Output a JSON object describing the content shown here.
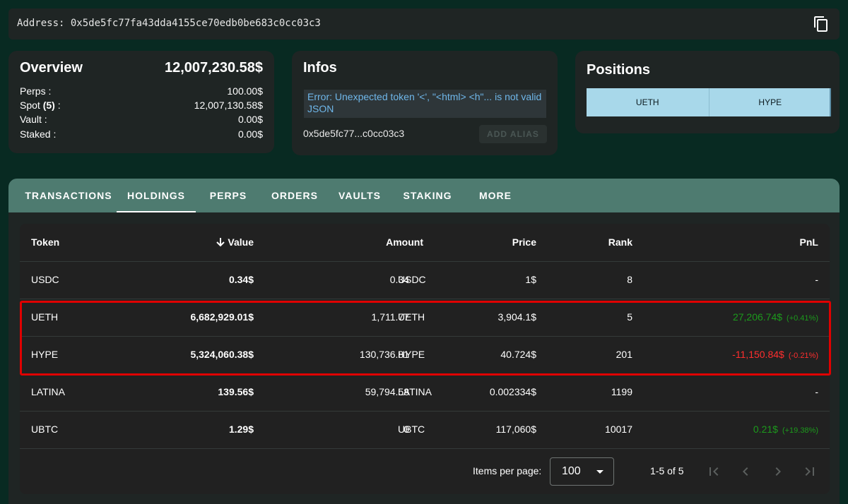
{
  "address_bar": {
    "text": "Address: 0x5de5fc77fa43dda4155ce70edb0be683c0cc03c3",
    "copy_icon": "copy-icon"
  },
  "overview": {
    "title": "Overview",
    "total": "12,007,230.58$",
    "rows": [
      {
        "label": "Perps :",
        "value": "100.00$"
      },
      {
        "label": "Spot (5) :",
        "label_prefix": "Spot ",
        "label_count": "(5)",
        "label_suffix": " :",
        "value": "12,007,130.58$"
      },
      {
        "label": "Vault :",
        "value": "0.00$"
      },
      {
        "label": "Staked :",
        "value": "0.00$"
      }
    ]
  },
  "infos": {
    "title": "Infos",
    "error": "Error: Unexpected token '<', \"<html> <h\"... is not valid JSON",
    "address_short": "0x5de5fc77...c0cc03c3",
    "add_alias_label": "ADD ALIAS"
  },
  "positions": {
    "title": "Positions",
    "tabs": [
      "UETH",
      "HYPE"
    ]
  },
  "tabs": [
    "TRANSACTIONS",
    "HOLDINGS",
    "PERPS",
    "ORDERS",
    "VAULTS",
    "STAKING",
    "MORE"
  ],
  "active_tab": "HOLDINGS",
  "table": {
    "headers": {
      "token": "Token",
      "value": "Value",
      "amount": "Amount",
      "price": "Price",
      "rank": "Rank",
      "pnl": "PnL"
    },
    "sort_icon": "arrow-down-icon",
    "rows": [
      {
        "token": "USDC",
        "value": "0.34$",
        "amount": "0.34",
        "symbol": "USDC",
        "price": "1$",
        "rank": "8",
        "pnl": "-",
        "pnl_pct": "",
        "pnl_sign": "none"
      },
      {
        "token": "UETH",
        "value": "6,682,929.01$",
        "amount": "1,711.77",
        "symbol": "UETH",
        "price": "3,904.1$",
        "rank": "5",
        "pnl": "27,206.74$",
        "pnl_pct": "(+0.41%)",
        "pnl_sign": "pos"
      },
      {
        "token": "HYPE",
        "value": "5,324,060.38$",
        "amount": "130,736.81",
        "symbol": "HYPE",
        "price": "40.724$",
        "rank": "201",
        "pnl": "-11,150.84$",
        "pnl_pct": "(-0.21%)",
        "pnl_sign": "neg"
      },
      {
        "token": "LATINA",
        "value": "139.56$",
        "amount": "59,794.58",
        "symbol": "LATINA",
        "price": "0.002334$",
        "rank": "1199",
        "pnl": "-",
        "pnl_pct": "",
        "pnl_sign": "none"
      },
      {
        "token": "UBTC",
        "value": "1.29$",
        "amount": "0",
        "symbol": "UBTC",
        "price": "117,060$",
        "rank": "10017",
        "pnl": "0.21$",
        "pnl_pct": "(+19.38%)",
        "pnl_sign": "pos"
      }
    ],
    "highlighted_rows": [
      "UETH",
      "HYPE"
    ],
    "footer": {
      "items_per_page_label": "Items per page:",
      "items_per_page_value": "100",
      "range": "1-5 of 5"
    }
  },
  "colors": {
    "background": "#082a22",
    "card": "#1f2524",
    "tab_bar": "#4e7b70",
    "positions_tab": "#a8d8ea",
    "error_text": "#6fb7ea",
    "pnl_positive": "#1c9a1c",
    "pnl_negative": "#ff2e2e",
    "highlight": "#e00000"
  }
}
